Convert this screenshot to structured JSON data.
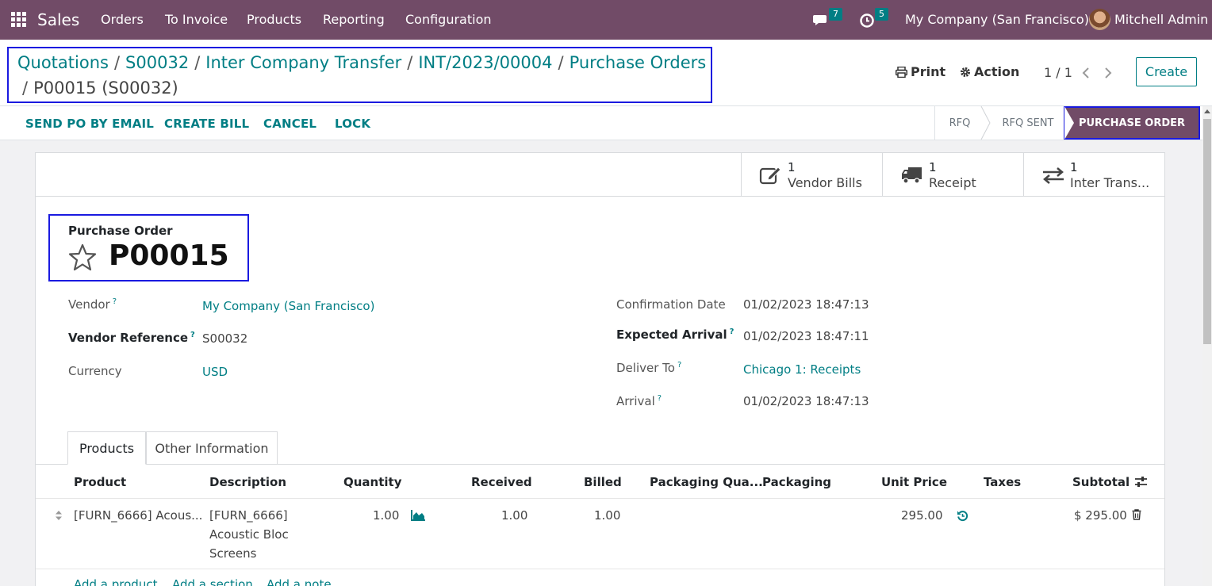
{
  "navbar": {
    "app_name": "Sales",
    "menu": [
      "Orders",
      "To Invoice",
      "Products",
      "Reporting",
      "Configuration"
    ],
    "messages_count": "7",
    "activities_count": "5",
    "company": "My Company (San Francisco)",
    "user": "Mitchell Admin"
  },
  "breadcrumb": {
    "links": [
      "Quotations",
      "S00032",
      "Inter Company Transfer",
      "INT/2023/00004",
      "Purchase Orders"
    ],
    "current": "P00015 (S00032)",
    "separator": "/"
  },
  "control": {
    "print_label": "Print",
    "action_label": "Action",
    "pager": "1 / 1",
    "create_label": "Create"
  },
  "statusbar": {
    "buttons": [
      "SEND PO BY EMAIL",
      "CREATE BILL",
      "CANCEL",
      "LOCK"
    ],
    "stages": [
      "RFQ",
      "RFQ SENT",
      "PURCHASE ORDER"
    ],
    "active_stage": "PURCHASE ORDER"
  },
  "smart_buttons": [
    {
      "count": "1",
      "label": "Vendor Bills",
      "icon": "pencil-square-icon"
    },
    {
      "count": "1",
      "label": "Receipt",
      "icon": "truck-icon"
    },
    {
      "count": "1",
      "label": "Inter Trans...",
      "icon": "exchange-icon"
    }
  ],
  "form": {
    "caption": "Purchase Order",
    "name": "P00015",
    "left_fields": [
      {
        "label": "Vendor",
        "help": "?",
        "value": "My Company (San Francisco)"
      },
      {
        "label": "Vendor Reference",
        "help": "?",
        "value": "S00032"
      },
      {
        "label": "Currency",
        "help": "",
        "value": "USD"
      }
    ],
    "right_fields": [
      {
        "label": "Confirmation Date",
        "help": "",
        "value": "01/02/2023 18:47:13"
      },
      {
        "label": "Expected Arrival",
        "help": "?",
        "value": "01/02/2023 18:47:11"
      },
      {
        "label": "Deliver To",
        "help": "?",
        "value": "Chicago 1: Receipts"
      },
      {
        "label": "Arrival",
        "help": "?",
        "value": "01/02/2023 18:47:13"
      }
    ]
  },
  "tabs": [
    "Products",
    "Other Information"
  ],
  "order_lines": {
    "columns": [
      "Product",
      "Description",
      "Quantity",
      "Received",
      "Billed",
      "Packaging Qua...",
      "Packaging",
      "Unit Price",
      "Taxes",
      "Subtotal"
    ],
    "rows": [
      {
        "product": "[FURN_6666] Acous...",
        "description_1": "[FURN_6666]",
        "description_2": "Acoustic Bloc",
        "description_3": "Screens",
        "quantity": "1.00",
        "received": "1.00",
        "billed": "1.00",
        "unit_price": "295.00",
        "subtotal": "$ 295.00"
      }
    ],
    "add_links": [
      "Add a product",
      "Add a section",
      "Add a note"
    ]
  },
  "colors": {
    "brand": "#714b67",
    "link": "#017e84",
    "highlight_box": "#1a1ae0"
  }
}
